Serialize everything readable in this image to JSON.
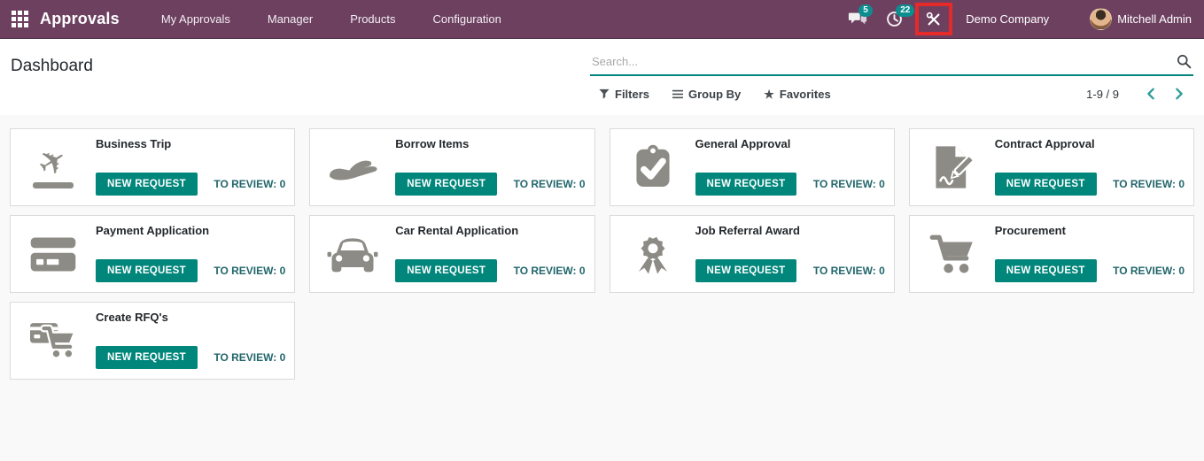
{
  "navbar": {
    "app_name": "Approvals",
    "menu": [
      "My Approvals",
      "Manager",
      "Products",
      "Configuration"
    ],
    "messages_count": "5",
    "activities_count": "22",
    "company_name": "Demo Company",
    "user_name": "Mitchell Admin",
    "icons": [
      "apps-grid-icon",
      "messages-icon",
      "activities-clock-icon",
      "developer-tools-icon",
      "avatar"
    ]
  },
  "annotation": {
    "type": "red-highlight-box",
    "target": "developer-tools-icon",
    "color": "#e52a2a"
  },
  "control_panel": {
    "page_title": "Dashboard",
    "search": {
      "placeholder": "Search...",
      "value": "",
      "icon": "search-icon"
    },
    "filters_label": "Filters",
    "group_by_label": "Group By",
    "favorites_label": "Favorites",
    "pager": {
      "range": "1-9 / 9",
      "icons": [
        "chevron-left-icon",
        "chevron-right-icon"
      ]
    }
  },
  "cards": [
    {
      "title": "Business Trip",
      "icon": "plane-departure-icon",
      "button_label": "NEW REQUEST",
      "to_review": "TO REVIEW: 0"
    },
    {
      "title": "Borrow Items",
      "icon": "borrow-hand-icon",
      "button_label": "NEW REQUEST",
      "to_review": "TO REVIEW: 0"
    },
    {
      "title": "General Approval",
      "icon": "clipboard-check-icon",
      "button_label": "NEW REQUEST",
      "to_review": "TO REVIEW: 0"
    },
    {
      "title": "Contract Approval",
      "icon": "contract-sign-icon",
      "button_label": "NEW REQUEST",
      "to_review": "TO REVIEW: 0"
    },
    {
      "title": "Payment Application",
      "icon": "credit-card-icon",
      "button_label": "NEW REQUEST",
      "to_review": "TO REVIEW: 0"
    },
    {
      "title": "Car Rental Application",
      "icon": "car-icon",
      "button_label": "NEW REQUEST",
      "to_review": "TO REVIEW: 0"
    },
    {
      "title": "Job Referral Award",
      "icon": "award-ribbon-icon",
      "button_label": "NEW REQUEST",
      "to_review": "TO REVIEW: 0"
    },
    {
      "title": "Procurement",
      "icon": "shopping-cart-icon",
      "button_label": "NEW REQUEST",
      "to_review": "TO REVIEW: 0"
    },
    {
      "title": "Create RFQ's",
      "icon": "rfq-card-cart-icon",
      "button_label": "NEW REQUEST",
      "to_review": "TO REVIEW: 0"
    }
  ],
  "colors": {
    "navbar_bg": "#6d4060",
    "accent_teal": "#00867b",
    "badge_teal": "#0c8d8f",
    "annotation_red": "#e52a2a",
    "to_review_text": "#21666b",
    "icon_gray": "#8d8b85",
    "page_bg": "#f9f9f9",
    "card_border": "#dadada"
  }
}
